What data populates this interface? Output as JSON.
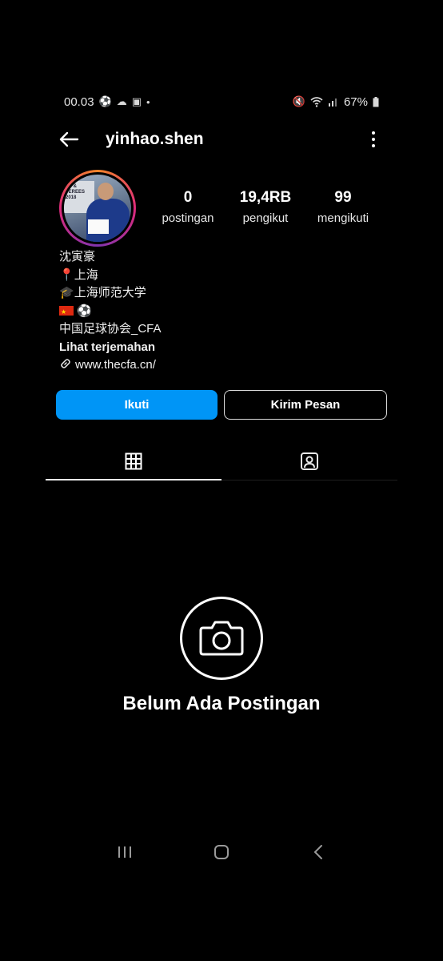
{
  "status_bar": {
    "time": "00.03",
    "battery": "67%",
    "left_icons": [
      "soccer-ball-icon",
      "cloud-icon",
      "gallery-icon",
      "dot-icon"
    ],
    "right_icons": [
      "mute-icon",
      "wifi-icon",
      "signal-icon",
      "battery-icon"
    ]
  },
  "header": {
    "username": "yinhao.shen"
  },
  "stats": [
    {
      "value": "0",
      "label": "postingan"
    },
    {
      "value": "19,4RB",
      "label": "pengikut"
    },
    {
      "value": "99",
      "label": "mengikuti"
    }
  ],
  "avatar": {
    "board_text": "ES &\nFEREES\n2018"
  },
  "bio": {
    "name": "沈寅豪",
    "location": "上海",
    "school": "上海师范大学",
    "emoji_line": "⚽",
    "organization": "中国足球协会_CFA",
    "translate": "Lihat terjemahan",
    "website": "www.thecfa.cn/"
  },
  "buttons": {
    "follow": "Ikuti",
    "message": "Kirim Pesan"
  },
  "empty_state": {
    "text": "Belum Ada Postingan"
  },
  "colors": {
    "background": "#000000",
    "follow_button": "#0095f6",
    "text": "#ffffff"
  }
}
